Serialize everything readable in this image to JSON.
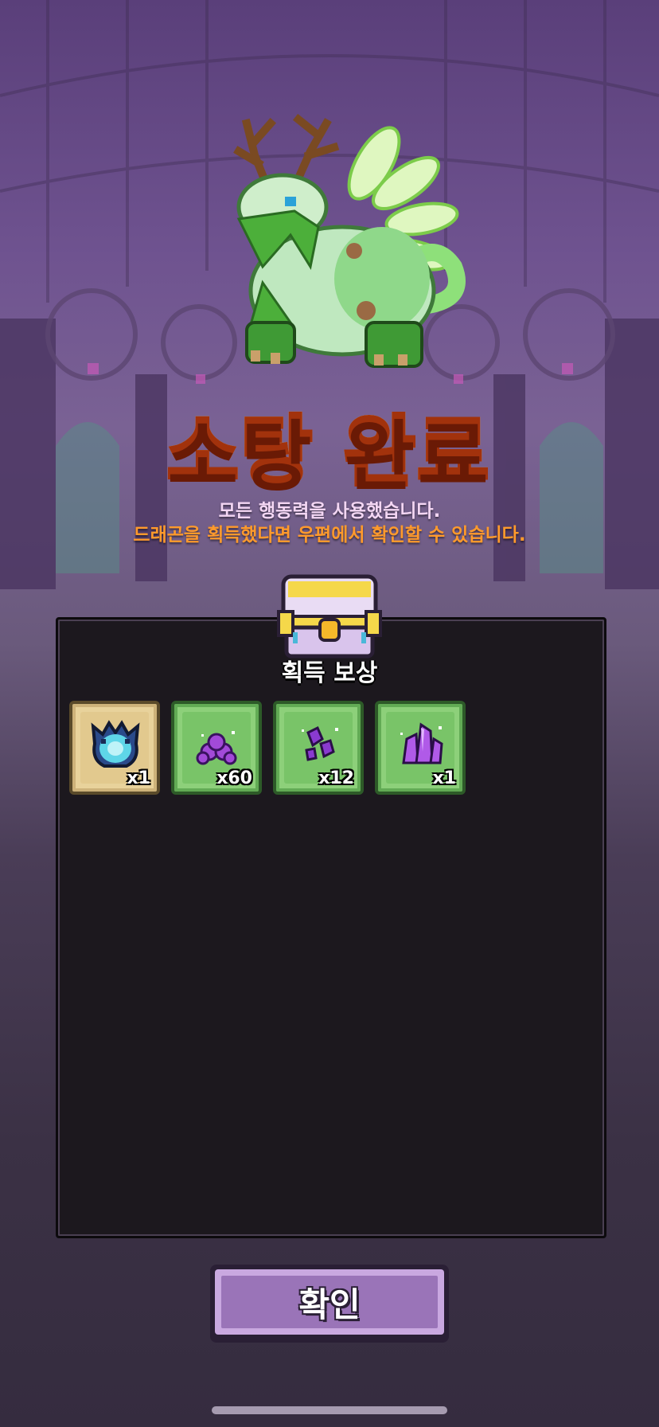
{
  "screen": {
    "title": "소탕 완료",
    "message_line1": "모든 행동력을 사용했습니다.",
    "message_line2": "드래곤을 획득했다면 우편에서 확인할 수 있습니다."
  },
  "reward_panel": {
    "heading": "획득 보상",
    "items": [
      {
        "icon": "dragon-egg-icon",
        "count": "x1",
        "frame": "tan"
      },
      {
        "icon": "purple-ore-pile-icon",
        "count": "x60",
        "frame": "green"
      },
      {
        "icon": "purple-gem-shards-icon",
        "count": "x12",
        "frame": "green"
      },
      {
        "icon": "purple-crystal-cluster-icon",
        "count": "x1",
        "frame": "green"
      }
    ]
  },
  "confirm_button": {
    "label": "확인"
  },
  "colors": {
    "title_fill": "#ffd34a",
    "title_outline": "#a2320c",
    "message_line1": "#f3d6f3",
    "message_line2": "#ff9a2c",
    "button": "#9a74b8"
  }
}
